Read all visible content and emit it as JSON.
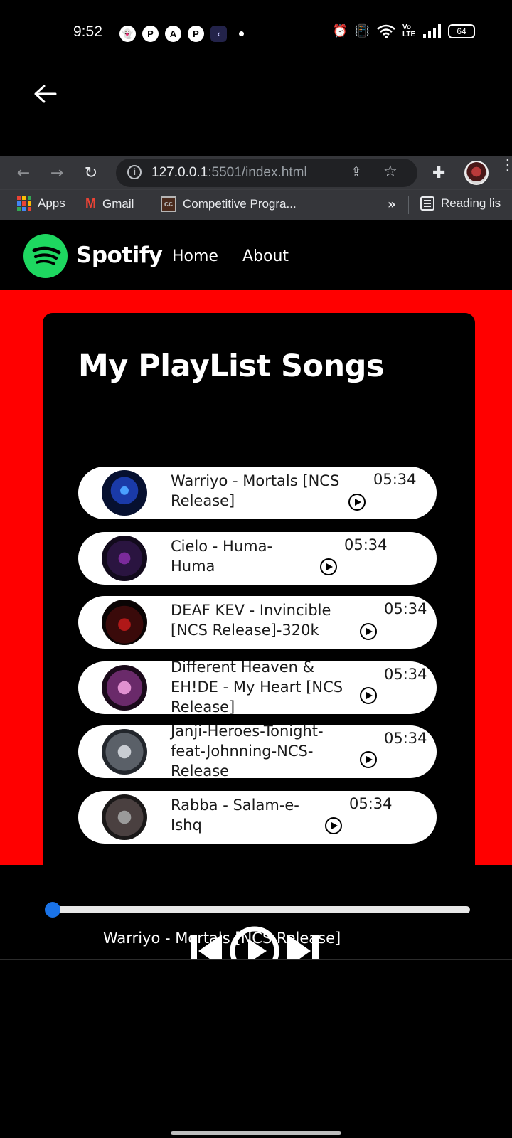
{
  "status_bar": {
    "time": "9:52",
    "notification_icons": [
      "snapchat-icon",
      "pinterest-icon",
      "acrobat-icon",
      "pinterest-icon",
      "back-app-icon"
    ],
    "system_icons": [
      "alarm-icon",
      "vibrate-icon",
      "wifi-icon",
      "volte-icon",
      "signal-icon"
    ],
    "volte": "Vo LTE",
    "battery": "64"
  },
  "browser": {
    "url_host": "127.0.0.1",
    "url_rest": ":5501/index.html",
    "bookmarks": [
      {
        "label": "Apps",
        "icon": "apps-grid-icon"
      },
      {
        "label": "Gmail",
        "icon": "gmail-icon"
      },
      {
        "label": "Competitive Progra...",
        "icon": "cc-icon"
      }
    ],
    "more_label": "»",
    "reading_list": "Reading lis"
  },
  "site": {
    "brand": "Spotify",
    "nav": [
      "Home",
      "About"
    ],
    "title": "My PlayList Songs",
    "accent_color": "#ff0000",
    "logo_color": "#1ed760"
  },
  "songs": [
    {
      "title": "Warriyo - Mortals [NCS Release]",
      "duration": "05:34"
    },
    {
      "title": "Cielo - Huma-Huma",
      "duration": "05:34"
    },
    {
      "title": "DEAF KEV - Invincible [NCS Release]-320k",
      "duration": "05:34"
    },
    {
      "title": "Different Heaven & EH!DE - My Heart [NCS Release]",
      "duration": "05:34"
    },
    {
      "title": "Janji-Heroes-Tonight-feat-Johnning-NCS-Release",
      "duration": "05:34"
    },
    {
      "title": "Rabba - Salam-e-Ishq",
      "duration": "05:34"
    }
  ],
  "player": {
    "now_playing": "Warriyo - Mortals [NCS Release]",
    "progress": 0.0
  }
}
